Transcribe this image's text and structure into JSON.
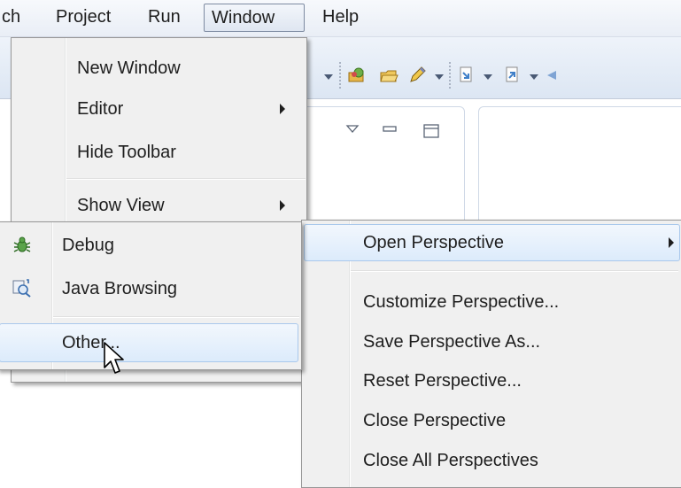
{
  "menubar": {
    "items": [
      {
        "label": "ch"
      },
      {
        "label": "Project"
      },
      {
        "label": "Run"
      },
      {
        "label": "Window"
      },
      {
        "label": "Help"
      }
    ]
  },
  "window_menu": {
    "items": [
      {
        "label": "New Window"
      },
      {
        "label": "Editor"
      },
      {
        "label": "Hide Toolbar"
      },
      {
        "label": "Show View"
      }
    ]
  },
  "perspective_menu": {
    "items": [
      {
        "label": "Open Perspective"
      },
      {
        "label": "Customize Perspective..."
      },
      {
        "label": "Save Perspective As..."
      },
      {
        "label": "Reset Perspective..."
      },
      {
        "label": "Close Perspective"
      },
      {
        "label": "Close All Perspectives"
      }
    ]
  },
  "open_perspective_submenu": {
    "items": [
      {
        "label": "Debug",
        "icon": "debug-bug-icon"
      },
      {
        "label": "Java Browsing",
        "icon": "java-browsing-icon"
      },
      {
        "label": "Other..."
      }
    ]
  },
  "colors": {
    "menu_bg": "#f0f0f0",
    "highlight_border": "#a9c8ec",
    "toolbar_bg": "#dce6f3"
  }
}
